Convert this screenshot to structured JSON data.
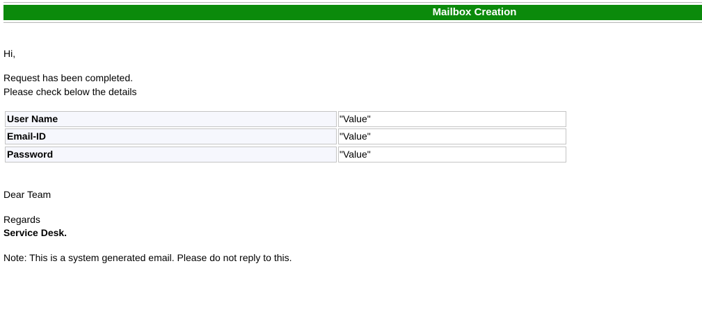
{
  "header": {
    "title": "Mailbox Creation",
    "bar_color": "#0b8a0b"
  },
  "greeting": "Hi,",
  "message": {
    "line1": "Request has been completed.",
    "line2": "Please check below the details"
  },
  "details": [
    {
      "label": "User Name",
      "value": "\"Value\""
    },
    {
      "label": "Email-ID",
      "value": "\"Value\""
    },
    {
      "label": "Password",
      "value": "\"Value\""
    }
  ],
  "closing": {
    "salutation": "Dear Team",
    "regards": "Regards",
    "signature": "Service Desk."
  },
  "note": "Note: This is a system generated email. Please do not reply to this."
}
